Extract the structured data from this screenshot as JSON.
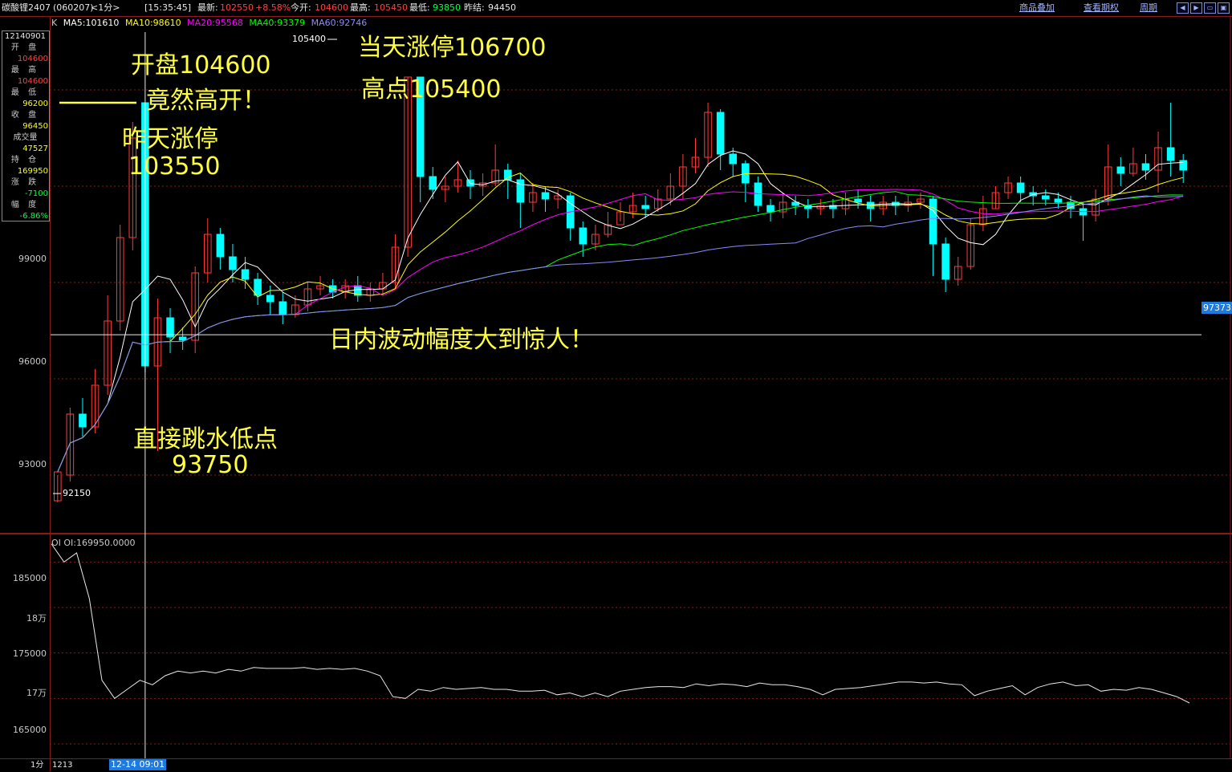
{
  "header": {
    "symbol": "碳酸锂2407",
    "code": "(060207)",
    "period": "<1分>",
    "time": "[15:35:45]",
    "latest_label": "最新:",
    "latest_value": "102550",
    "change_pct": "+8.58%",
    "open_label": "今开:",
    "open_value": "104600",
    "high_label": "最高:",
    "high_value": "105450",
    "low_label": "最低:",
    "low_value": "93850",
    "prev_close_label": "昨结:",
    "prev_close_value": "94450",
    "link_overlay": "商品叠加",
    "link_options": "查看期权",
    "link_period": "周期"
  },
  "ma_legend": {
    "k": "K",
    "ma5": "MA5:101610",
    "ma10": "MA10:98610",
    "ma20": "MA20:95568",
    "ma40": "MA40:93379",
    "ma60": "MA60:92746"
  },
  "info_panel": {
    "date": "12140901",
    "open_label": "开 盘",
    "open": "104600",
    "high_label": "最 高",
    "high": "104600",
    "low_label": "最 低",
    "low": "96200",
    "close_label": "收 盘",
    "close": "96450",
    "volume_label": "成交量",
    "volume": "47527",
    "oi_label": "持 仓",
    "oi": "169950",
    "change_label": "涨 跌",
    "change": "-7100",
    "pct_label": "幅 度",
    "pct": "-6.86%"
  },
  "price_axis": [
    "99000",
    "96000",
    "93000"
  ],
  "oi_axis": [
    "185000",
    "18万",
    "175000",
    "17万",
    "165000"
  ],
  "current_price_tag": "97373",
  "markers": {
    "high_marker": "105400",
    "low_marker": "92150"
  },
  "oi_legend": "OI  OI:169950.0000",
  "bottom": {
    "period": "1分",
    "date_left": "1213",
    "time_tag": "12-14 09:01"
  },
  "annotations": {
    "open_note": "开盘104600",
    "open_note2": "竟然高开！",
    "yesterday": "昨天涨停",
    "yesterday_val": "103550",
    "dive": "直接跳水低点",
    "dive_val": "93750",
    "limit_up": "当天涨停106700",
    "high_note": "高点105400",
    "volatility": "日内波动幅度大到惊人！"
  },
  "colors": {
    "up": "#ff3b3b",
    "down": "#00ffff",
    "ma5": "#ffffff",
    "ma10": "#ffff00",
    "ma20": "#ff00ff",
    "ma40": "#00ff00",
    "ma60": "#8a8aff",
    "grid": "#8a1a1a"
  },
  "chart_data": {
    "type": "candlestick",
    "price_axis_ticks": [
      93000,
      96000,
      99000
    ],
    "price_range": [
      91300,
      106800
    ],
    "current_price_line": 97373,
    "candles": [
      [
        92200,
        93100,
        93000,
        92150
      ],
      [
        93000,
        94900,
        95100,
        92800
      ],
      [
        94900,
        94500,
        95400,
        94200
      ],
      [
        94500,
        95800,
        96300,
        94300
      ],
      [
        95800,
        97800,
        98600,
        95500
      ],
      [
        97800,
        100400,
        100800,
        97500
      ],
      [
        100400,
        103500,
        104000,
        100000
      ],
      [
        104600,
        96400,
        104600,
        96200
      ],
      [
        96400,
        97900,
        98500,
        93750
      ],
      [
        97900,
        97300,
        98200,
        96800
      ],
      [
        97300,
        97200,
        97600,
        96900
      ],
      [
        97200,
        99300,
        99500,
        96800
      ],
      [
        99300,
        100500,
        101000,
        99000
      ],
      [
        100500,
        99800,
        100700,
        99400
      ],
      [
        99800,
        99400,
        100200,
        99000
      ],
      [
        99400,
        99100,
        99800,
        98800
      ],
      [
        99100,
        98600,
        99300,
        98300
      ],
      [
        98600,
        98400,
        98900,
        98000
      ],
      [
        98400,
        98000,
        98700,
        97700
      ],
      [
        98000,
        98300,
        98600,
        97900
      ],
      [
        98300,
        98800,
        99000,
        98100
      ],
      [
        98800,
        98900,
        99200,
        98600
      ],
      [
        98900,
        98700,
        99100,
        98500
      ],
      [
        98700,
        98900,
        99100,
        98500
      ],
      [
        98900,
        98600,
        99200,
        98400
      ],
      [
        98600,
        98800,
        99000,
        98400
      ],
      [
        98800,
        99000,
        99300,
        98600
      ],
      [
        99000,
        100100,
        100500,
        98800
      ],
      [
        100100,
        105400,
        105400,
        99800
      ],
      [
        105400,
        102300,
        105400,
        101500
      ],
      [
        102300,
        101900,
        102600,
        101600
      ],
      [
        101900,
        102000,
        102300,
        101500
      ],
      [
        102000,
        102200,
        102800,
        101800
      ],
      [
        102200,
        102000,
        102500,
        101600
      ],
      [
        102000,
        102100,
        102400,
        101700
      ],
      [
        102100,
        102500,
        103300,
        102000
      ],
      [
        102500,
        102200,
        102700,
        101600
      ],
      [
        102200,
        101500,
        102400,
        100700
      ],
      [
        101500,
        101800,
        102100,
        101200
      ],
      [
        101800,
        101600,
        102000,
        101200
      ],
      [
        101600,
        101700,
        101900,
        101300
      ],
      [
        101700,
        100700,
        101800,
        100300
      ],
      [
        100700,
        100200,
        100900,
        99800
      ],
      [
        100200,
        100500,
        100800,
        100000
      ],
      [
        100500,
        100800,
        101200,
        100400
      ],
      [
        100800,
        101200,
        101500,
        100900
      ],
      [
        101200,
        101400,
        101800,
        101000
      ],
      [
        101400,
        101300,
        101700,
        101000
      ],
      [
        101300,
        101600,
        101900,
        101200
      ],
      [
        101600,
        102000,
        102400,
        101400
      ],
      [
        102000,
        102600,
        103000,
        101600
      ],
      [
        102600,
        102900,
        103500,
        102400
      ],
      [
        102900,
        104300,
        104600,
        102600
      ],
      [
        104300,
        103000,
        104400,
        102500
      ],
      [
        103000,
        102700,
        103200,
        102300
      ],
      [
        102700,
        102100,
        102800,
        101500
      ],
      [
        102100,
        101400,
        102300,
        101200
      ],
      [
        101400,
        101200,
        101600,
        100900
      ],
      [
        101200,
        101500,
        101800,
        101000
      ],
      [
        101500,
        101400,
        101700,
        101100
      ],
      [
        101400,
        101300,
        101600,
        101000
      ],
      [
        101300,
        101400,
        101600,
        101100
      ],
      [
        101400,
        101300,
        101600,
        101000
      ],
      [
        101300,
        101600,
        101800,
        101100
      ],
      [
        101600,
        101500,
        101900,
        101300
      ],
      [
        101500,
        101300,
        101700,
        100900
      ],
      [
        101300,
        101500,
        101700,
        101100
      ],
      [
        101500,
        101400,
        101700,
        101100
      ],
      [
        101400,
        101500,
        101700,
        101200
      ],
      [
        101500,
        101600,
        101800,
        101300
      ],
      [
        101600,
        100200,
        101700,
        99200
      ],
      [
        100200,
        99100,
        100400,
        98700
      ],
      [
        99100,
        99500,
        99800,
        98900
      ],
      [
        99500,
        100800,
        101000,
        99400
      ],
      [
        100800,
        101300,
        101700,
        100600
      ],
      [
        101300,
        101800,
        102000,
        101300
      ],
      [
        101800,
        102100,
        102300,
        101600
      ],
      [
        102100,
        101800,
        102300,
        101500
      ],
      [
        101800,
        101700,
        102000,
        101400
      ],
      [
        101700,
        101600,
        101900,
        101400
      ],
      [
        101600,
        101500,
        101800,
        101300
      ],
      [
        101500,
        101300,
        101700,
        101000
      ],
      [
        101300,
        101100,
        101500,
        100300
      ],
      [
        101100,
        101600,
        101900,
        100900
      ],
      [
        101600,
        102600,
        103300,
        101400
      ],
      [
        102600,
        102400,
        102900,
        102000
      ],
      [
        102400,
        102700,
        103200,
        102300
      ],
      [
        102700,
        102500,
        103000,
        102200
      ],
      [
        102500,
        103200,
        103700,
        101800
      ],
      [
        103200,
        102800,
        104600,
        102300
      ],
      [
        102800,
        102500,
        103000,
        102100
      ]
    ],
    "oi_axis_ticks": [
      165000,
      170000,
      175000,
      180000,
      185000
    ],
    "oi_range": [
      163500,
      187500
    ],
    "oi_series": [
      187000,
      185000,
      186000,
      181000,
      172000,
      170000,
      171000,
      172000,
      171500,
      172500,
      173000,
      172800,
      173000,
      172800,
      173200,
      173000,
      173400,
      173300,
      173300,
      173300,
      173400,
      173200,
      173300,
      173200,
      173300,
      173000,
      172500,
      170200,
      170000,
      171000,
      170800,
      171200,
      171000,
      171100,
      171200,
      171000,
      171000,
      170800,
      170800,
      170900,
      170400,
      170600,
      170200,
      170600,
      170200,
      170800,
      171000,
      171200,
      171300,
      171300,
      171200,
      171600,
      171400,
      171600,
      171500,
      171300,
      171700,
      171500,
      171500,
      171300,
      171000,
      170400,
      171000,
      171100,
      171200,
      171400,
      171600,
      171800,
      171800,
      171700,
      171800,
      171600,
      171500,
      170300,
      170800,
      171100,
      171400,
      170400,
      171200,
      171600,
      171800,
      171400,
      171500,
      170800,
      171000,
      170900,
      171200,
      171000,
      170600,
      170200,
      169500
    ]
  }
}
